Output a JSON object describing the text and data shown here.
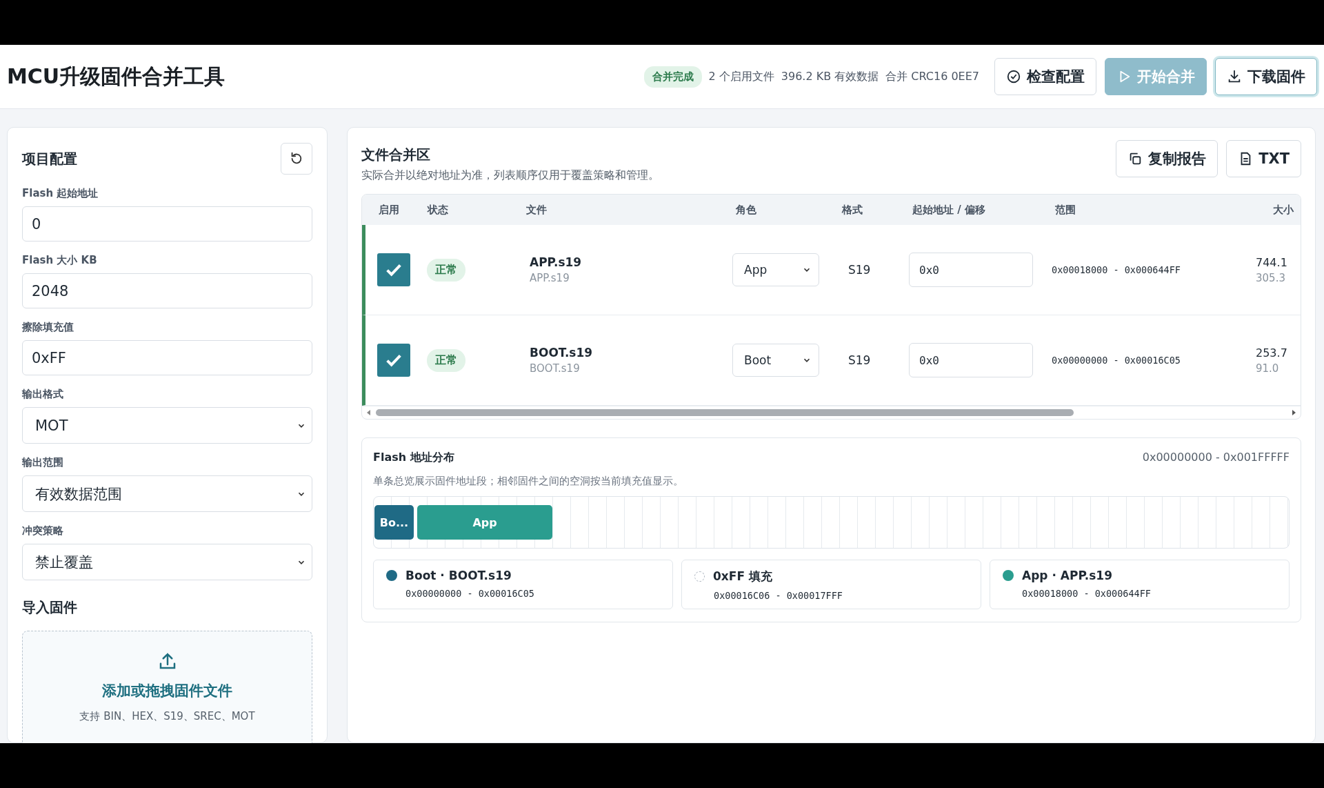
{
  "header": {
    "title": "MCU升级固件合并工具",
    "status_badge": "合并完成",
    "stats": [
      "2 个启用文件",
      "396.2 KB 有效数据",
      "合并 CRC16 0EE7"
    ],
    "buttons": [
      {
        "label": "检查配置",
        "kind": "check",
        "disabled": false,
        "focused": false
      },
      {
        "label": "开始合并",
        "kind": "start",
        "disabled": true,
        "focused": false
      },
      {
        "label": "下载固件",
        "kind": "download",
        "disabled": false,
        "focused": true
      }
    ]
  },
  "config_panel": {
    "title": "项目配置",
    "fields": [
      {
        "label": "Flash 起始地址",
        "value": "0",
        "kind": "input"
      },
      {
        "label": "Flash 大小 KB",
        "value": "2048",
        "kind": "input"
      },
      {
        "label": "擦除填充值",
        "value": "0xFF",
        "kind": "input"
      },
      {
        "label": "输出格式",
        "value": "MOT",
        "kind": "select"
      },
      {
        "label": "输出范围",
        "value": "有效数据范围",
        "kind": "select"
      },
      {
        "label": "冲突策略",
        "value": "禁止覆盖",
        "kind": "select"
      }
    ],
    "import": {
      "title": "导入固件",
      "drop_title": "添加或拖拽固件文件",
      "drop_hint": "支持 BIN、HEX、S19、SREC、MOT"
    }
  },
  "merge_panel": {
    "title": "文件合并区",
    "subtitle": "实际合并以绝对地址为准，列表顺序仅用于覆盖策略和管理。",
    "actions": [
      {
        "label": "复制报告",
        "kind": "copy"
      },
      {
        "label": "TXT",
        "kind": "file"
      }
    ],
    "table": {
      "columns": [
        "启用",
        "状态",
        "文件",
        "角色",
        "格式",
        "起始地址 / 偏移",
        "范围",
        "大小"
      ],
      "rows": [
        {
          "enabled": true,
          "status": "正常",
          "file": "APP.s19",
          "file_sub": "APP.s19",
          "role": "App",
          "format": "S19",
          "offset": "0x0",
          "range": "0x00018000 - 0x000644FF",
          "size": "744.1",
          "size_sub": "305.3"
        },
        {
          "enabled": true,
          "status": "正常",
          "file": "BOOT.s19",
          "file_sub": "BOOT.s19",
          "role": "Boot",
          "format": "S19",
          "offset": "0x0",
          "range": "0x00000000 - 0x00016C05",
          "size": "253.7",
          "size_sub": "91.0"
        }
      ]
    }
  },
  "flash_map": {
    "title": "Flash 地址分布",
    "range": "0x00000000 - 0x001FFFFF",
    "description": "单条总览展示固件地址段；相邻固件之间的空洞按当前填充值显示。",
    "segments": [
      {
        "label": "Bo...",
        "color": "#1f6a85"
      },
      {
        "label": "App",
        "color": "#2a9d8f"
      }
    ],
    "legend": [
      {
        "kind": "file",
        "label": "Boot · BOOT.s19",
        "range": "0x00000000 - 0x00016C05",
        "color": "#1f6a85"
      },
      {
        "kind": "fill",
        "label": "0xFF 填充",
        "range": "0x00016C06 - 0x00017FFF"
      },
      {
        "kind": "file",
        "label": "App · APP.s19",
        "range": "0x00018000 - 0x000644FF",
        "color": "#2a9d8f"
      }
    ]
  }
}
